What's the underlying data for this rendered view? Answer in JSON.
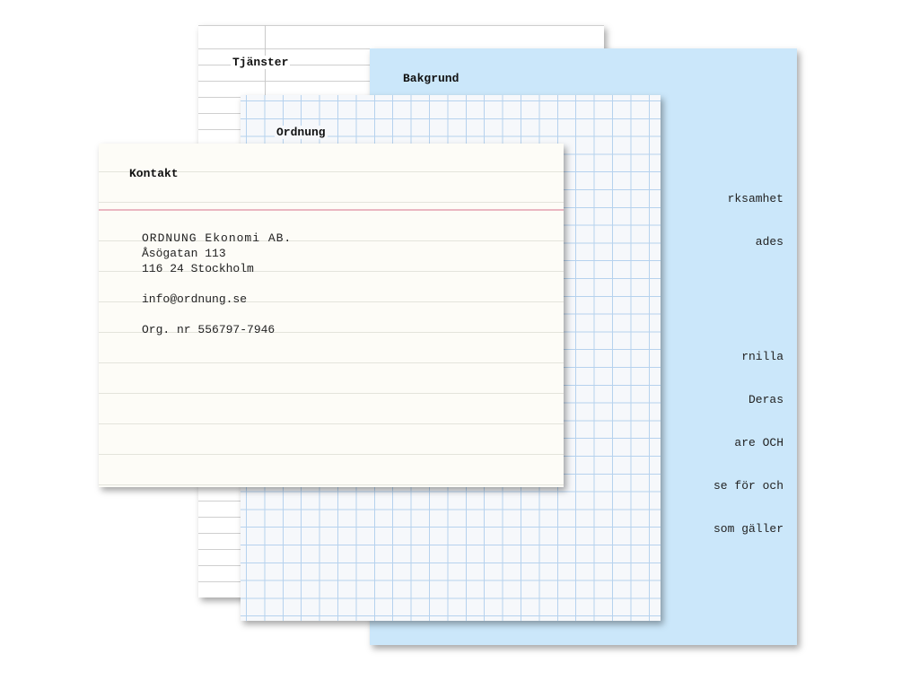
{
  "cards": {
    "tjanster": {
      "title": "Tjänster"
    },
    "bakgrund": {
      "title": "Bakgrund",
      "paragraphs": [
        [
          "rksamhet",
          "ades"
        ],
        [
          "rnilla",
          "Deras",
          "are OCH",
          "se för och",
          "som gäller"
        ]
      ]
    },
    "ordnung": {
      "title": "Ordnung"
    },
    "kontakt": {
      "title": "Kontakt",
      "company": "ORDNUNG Ekonomi AB.",
      "street": "Åsögatan 113",
      "city": "116 24 Stockholm",
      "email": "info@ordnung.se",
      "org": "Org. nr 556797-7946"
    }
  },
  "colors": {
    "bakgrund_card": "#cbe7fa",
    "grid_lines": "#b6d2ee",
    "kontakt_margin_line": "#eab7c2",
    "kontakt_card": "#fdfcf7"
  }
}
